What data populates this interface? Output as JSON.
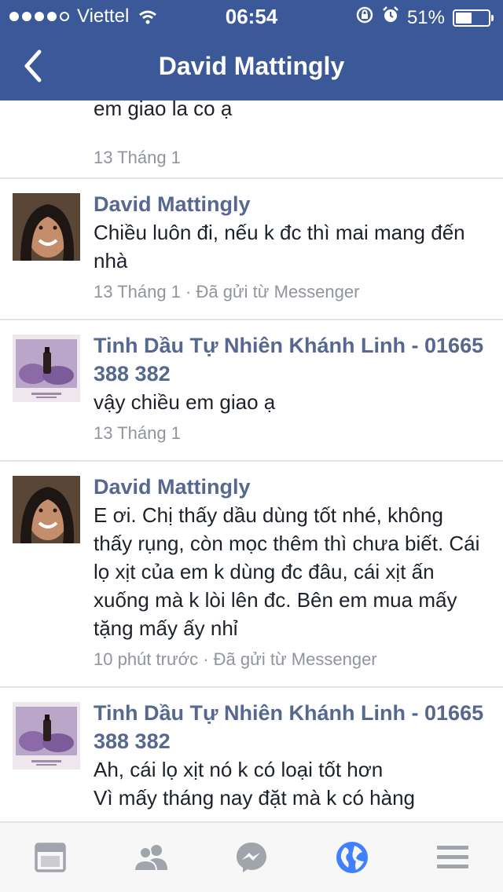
{
  "status_bar": {
    "carrier": "Viettel",
    "time": "06:54",
    "battery_percent": "51%",
    "battery_level": 0.51
  },
  "nav": {
    "title": "David Mattingly"
  },
  "messages": [
    {
      "body": "em giao la co ạ",
      "meta": "13 Tháng 1"
    },
    {
      "sender": "David Mattingly",
      "body": "Chiều luôn đi, nếu k đc thì mai mang đến nhà",
      "meta": "13 Tháng 1 · Đã gửi từ Messenger"
    },
    {
      "sender": "Tinh Dầu Tự Nhiên Khánh Linh - 01665 388 382",
      "body": "vậy chiều em giao ạ",
      "meta": "13 Tháng 1"
    },
    {
      "sender": "David Mattingly",
      "body": "E ơi. Chị thấy dầu dùng tốt nhé, không thấy rụng, còn mọc thêm thì chưa biết. Cái lọ xịt của em k dùng đc đâu, cái xịt ấn xuống mà k lòi lên đc. Bên em mua mấy tặng mấy ấy nhỉ",
      "meta": "10 phút trước · Đã gửi từ Messenger"
    },
    {
      "sender": "Tinh Dầu Tự Nhiên Khánh Linh - 01665 388 382",
      "body": "Ah, cái lọ xịt nó k có loại tốt hơn",
      "body2": "Vì mấy tháng nay đặt mà k có hàng"
    }
  ],
  "tabbar": {
    "icons": [
      "news-feed-icon",
      "friends-icon",
      "messenger-icon",
      "notifications-globe-icon",
      "menu-icon"
    ],
    "active_index": 3,
    "active_color": "#4080ff",
    "inactive_color": "#a0a4ab"
  },
  "colors": {
    "header": "#3b5998",
    "sender": "#56688f",
    "meta": "#90949c"
  }
}
